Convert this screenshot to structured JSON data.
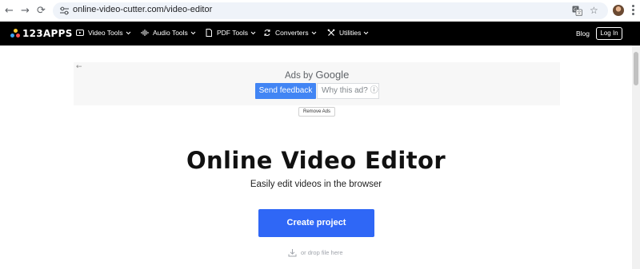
{
  "browser": {
    "url_host": "online-video-cutter.com",
    "url_path": "/video-editor",
    "back_icon": "←",
    "forward_icon": "→",
    "reload_icon": "⟳",
    "translate_icon": "translate-icon",
    "star_icon": "☆"
  },
  "nav": {
    "logo_text": "123APPS",
    "items": [
      {
        "label": "Video Tools",
        "icon": "video-icon"
      },
      {
        "label": "Audio Tools",
        "icon": "audio-wave-icon"
      },
      {
        "label": "PDF Tools",
        "icon": "pdf-file-icon"
      },
      {
        "label": "Converters",
        "icon": "converters-icon"
      },
      {
        "label": "Utilities",
        "icon": "utilities-icon"
      }
    ],
    "blog_label": "Blog",
    "login_label": "Log In"
  },
  "ad": {
    "back_arrow": "←",
    "ads_by_label": "Ads by",
    "google_label": "Google",
    "send_feedback_label": "Send feedback",
    "why_this_ad_label": "Why this ad? ⓘ",
    "remove_ads_label": "Remove Ads"
  },
  "hero": {
    "title": "Online Video Editor",
    "subtitle": "Easily edit videos in the browser",
    "create_button_label": "Create project",
    "drop_label": "or drop file here"
  },
  "colors": {
    "nav_background": "#000000",
    "primary_button": "#2f67f6",
    "feedback_button": "#4285f4",
    "logo_dot_1": "#ffcc33",
    "logo_dot_2": "#3ea4f0",
    "logo_dot_3": "#ff4d4d"
  }
}
